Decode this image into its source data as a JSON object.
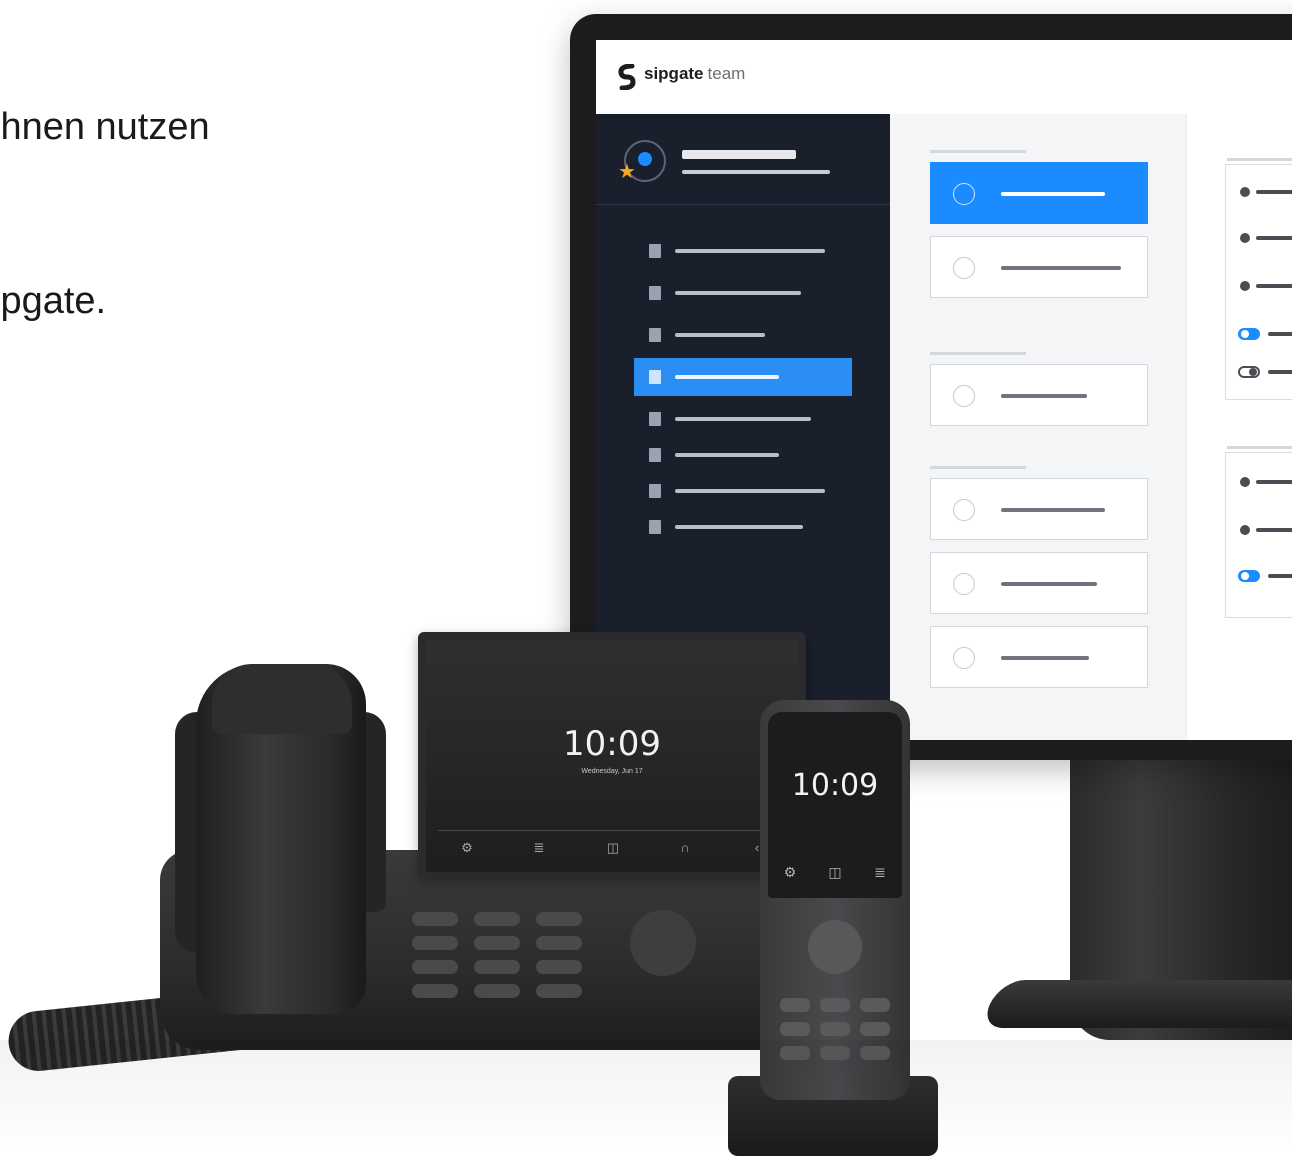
{
  "hero": {
    "line1": "ihnen nutzen",
    "line2": "ipgate."
  },
  "app": {
    "brand_name": "sipgate",
    "brand_suffix": "team",
    "accent_color": "#1a8cff",
    "sidebar_color": "#1a1f2c"
  },
  "desk_phone": {
    "time": "10:09",
    "date": "Wednesday, Jun 17",
    "icons": [
      "gear-icon",
      "voicemail-icon",
      "book-icon",
      "headset-icon",
      "forward-icon"
    ]
  },
  "cordless": {
    "time": "10:09",
    "icons": [
      "gear-icon",
      "book-icon",
      "voicemail-icon"
    ]
  }
}
